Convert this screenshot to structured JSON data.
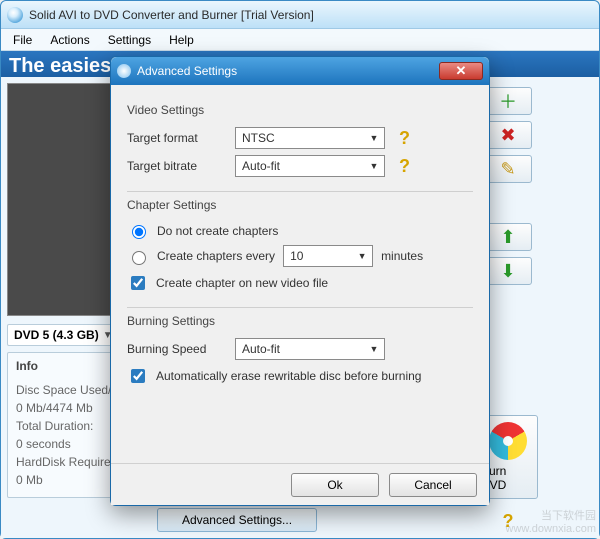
{
  "window": {
    "title": "Solid AVI to DVD Converter and Burner [Trial Version]"
  },
  "menu": [
    "File",
    "Actions",
    "Settings",
    "Help"
  ],
  "banner": "The easies",
  "dvd_bar": {
    "label": "DVD 5  (4.3 GB)"
  },
  "info": {
    "header": "Info",
    "disc_label": "Disc Space Used/Tot...",
    "disc_value": "0 Mb/4474 Mb",
    "duration_label": "Total Duration:",
    "duration_value": "0 seconds",
    "hdd_label": "HardDisk Required:",
    "hdd_value": "0 Mb"
  },
  "advanced_button": "Advanced Settings...",
  "sidebar": {
    "add_icon": "＋",
    "delete_icon": "✖",
    "edit_icon": "✎",
    "up_icon": "⬆",
    "down_icon": "⬇",
    "burn_label": "Burn DVD"
  },
  "dialog": {
    "title": "Advanced Settings",
    "video_section": "Video Settings",
    "target_format_label": "Target format",
    "target_format_value": "NTSC",
    "target_bitrate_label": "Target bitrate",
    "target_bitrate_value": "Auto-fit",
    "chapter_section": "Chapter Settings",
    "radio_no_chapters": "Do not create chapters",
    "radio_create_every": "Create chapters every",
    "every_value": "10",
    "every_unit": "minutes",
    "check_new_file": "Create chapter on new video file",
    "burning_section": "Burning Settings",
    "burning_speed_label": "Burning Speed",
    "burning_speed_value": "Auto-fit",
    "check_erase": "Automatically erase rewritable disc before burning",
    "ok": "Ok",
    "cancel": "Cancel"
  },
  "watermark": {
    "line1": "当下软件园",
    "line2": "www.downxia.com"
  }
}
